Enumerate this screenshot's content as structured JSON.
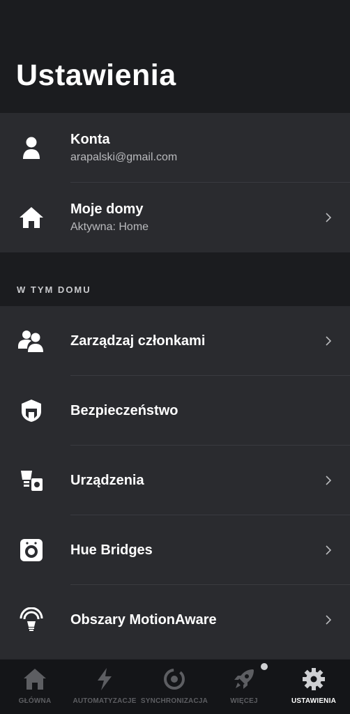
{
  "header": {
    "title": "Ustawienia"
  },
  "account_section": {
    "items": [
      {
        "title": "Konta",
        "subtitle": "arapalski@gmail.com",
        "icon": "person-icon"
      },
      {
        "title": "Moje domy",
        "subtitle": "Aktywna: Home",
        "icon": "home-icon"
      }
    ]
  },
  "home_section": {
    "label": "W TYM DOMU",
    "items": [
      {
        "title": "Zarządzaj członkami",
        "icon": "members-icon"
      },
      {
        "title": "Bezpieczeństwo",
        "icon": "security-shield-icon"
      },
      {
        "title": "Urządzenia",
        "icon": "devices-icon"
      },
      {
        "title": "Hue Bridges",
        "icon": "bridge-icon"
      },
      {
        "title": "Obszary MotionAware",
        "icon": "motion-aware-icon"
      }
    ]
  },
  "bottom_nav": {
    "items": [
      {
        "label": "GŁÓWNA",
        "icon": "home-icon",
        "active": false
      },
      {
        "label": "AUTOMATYZACJE",
        "icon": "lightning-icon",
        "active": false
      },
      {
        "label": "SYNCHRONIZACJA",
        "icon": "sync-icon",
        "active": false
      },
      {
        "label": "WIĘCEJ",
        "icon": "rocket-icon",
        "active": false
      },
      {
        "label": "USTAWIENIA",
        "icon": "gear-icon",
        "active": true
      }
    ]
  },
  "colors": {
    "background": "#1b1c1f",
    "card": "#2a2b2f",
    "text_primary": "#ffffff",
    "text_secondary": "#b9babd",
    "nav_inactive": "#5d5e62"
  }
}
